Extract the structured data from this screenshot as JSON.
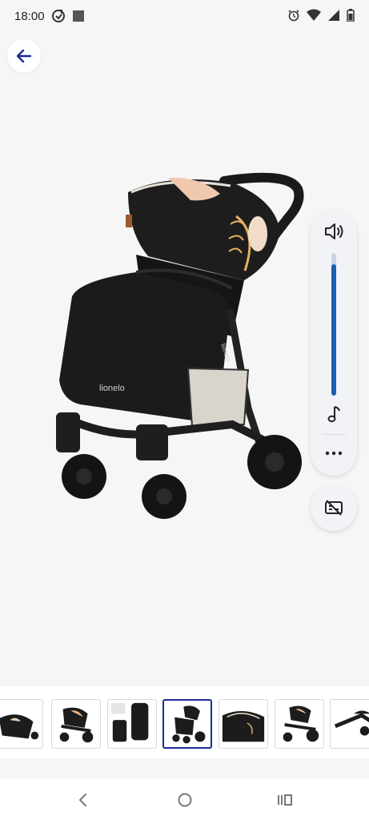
{
  "status": {
    "time": "18:00",
    "left_icons": [
      "sync-icon",
      "app-square-icon"
    ],
    "right_icons": [
      "alarm-icon",
      "wifi-icon",
      "signal-icon",
      "battery-icon"
    ]
  },
  "header": {
    "back_icon": "arrow-left-icon",
    "accent_color": "#1a2a9a"
  },
  "product": {
    "brand_on_footmuff": "lionelo",
    "brand_on_frame": "lionelo"
  },
  "volume_panel": {
    "level": 0.92,
    "icons": [
      "speaker-icon",
      "music-note-icon",
      "more-dots-icon"
    ],
    "accent_color": "#1a5fb4"
  },
  "caption_toggle": {
    "icon": "captions-off-icon"
  },
  "thumbnails": [
    {
      "name": "thumb-1",
      "selected": false
    },
    {
      "name": "thumb-2",
      "selected": false
    },
    {
      "name": "thumb-3",
      "selected": false
    },
    {
      "name": "thumb-4",
      "selected": true
    },
    {
      "name": "thumb-5",
      "selected": false
    },
    {
      "name": "thumb-6",
      "selected": false
    },
    {
      "name": "thumb-7",
      "selected": false
    }
  ],
  "navigation": {
    "icons": [
      "nav-back-icon",
      "nav-home-icon",
      "nav-recents-icon"
    ]
  }
}
